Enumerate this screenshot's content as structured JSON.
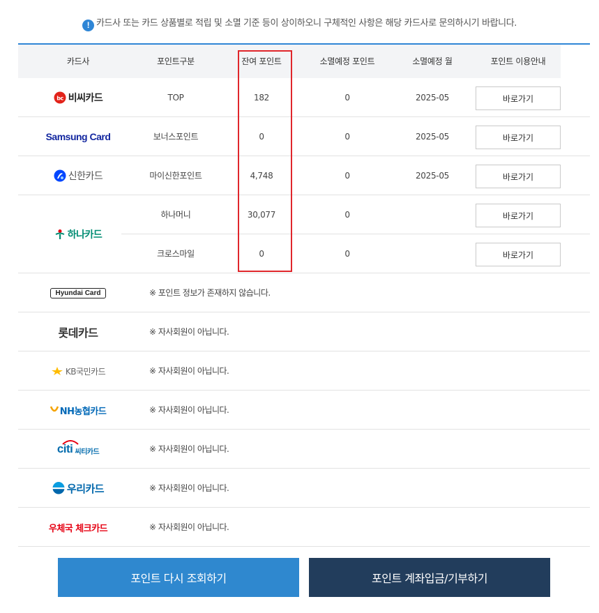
{
  "notice": {
    "icon": "!",
    "text": "카드사 또는 카드 상품별로 적립 및 소멸 기준 등이 상이하오니 구체적인 사항은 해당 카드사로 문의하시기 바랍니다."
  },
  "headers": [
    "카드사",
    "포인트구분",
    "잔여 포인트",
    "소멸예정 포인트",
    "소멸예정 월",
    "포인트 이용안내"
  ],
  "cards": {
    "bc": {
      "logo": "비씨카드",
      "type": "TOP",
      "balance": "182",
      "expiring": "0",
      "month": "2025-05",
      "button": "바로가기"
    },
    "samsung": {
      "logo": "Samsung Card",
      "type": "보너스포인트",
      "balance": "0",
      "expiring": "0",
      "month": "2025-05",
      "button": "바로가기"
    },
    "shinhan": {
      "logo": "신한카드",
      "type": "마이신한포인트",
      "balance": "4,748",
      "expiring": "0",
      "month": "2025-05",
      "button": "바로가기"
    },
    "hana": {
      "logo": "하나카드",
      "rows": [
        {
          "type": "하나머니",
          "balance": "30,077",
          "expiring": "0",
          "button": "바로가기"
        },
        {
          "type": "크로스마일",
          "balance": "0",
          "expiring": "0",
          "button": "바로가기"
        }
      ]
    },
    "hyundai": {
      "logo": "Hyundai Card",
      "message": "※ 포인트 정보가 존재하지 않습니다."
    },
    "lotte": {
      "logo": "롯데카드",
      "message": "※ 자사회원이 아닙니다."
    },
    "kb": {
      "logo": "KB국민카드",
      "message": "※ 자사회원이 아닙니다."
    },
    "nh": {
      "logo": "NH농협카드",
      "message": "※ 자사회원이 아닙니다."
    },
    "citi": {
      "logo_main": "citi",
      "logo_sub": "씨티카드",
      "message": "※ 자사회원이 아닙니다."
    },
    "woori": {
      "logo": "우리카드",
      "message": "※ 자사회원이 아닙니다."
    },
    "post": {
      "logo": "우체국 체크카드",
      "message": "※ 자사회원이 아닙니다."
    }
  },
  "buttons": {
    "refresh": "포인트 다시 조회하기",
    "deposit": "포인트 계좌입금/기부하기"
  },
  "colors": {
    "accent": "#2f86d6",
    "highlight": "#e0262b",
    "deposit_btn": "#223d5c",
    "bc_red": "#e2231a",
    "samsung_blue": "#1428a0",
    "hana_green": "#008c73",
    "lotte_text": "#333333",
    "kb_yellow": "#ffbc00",
    "nh_blue": "#0068b7",
    "citi_blue": "#056dae",
    "woori_blue": "#0067ac",
    "post_red": "#e60012"
  }
}
